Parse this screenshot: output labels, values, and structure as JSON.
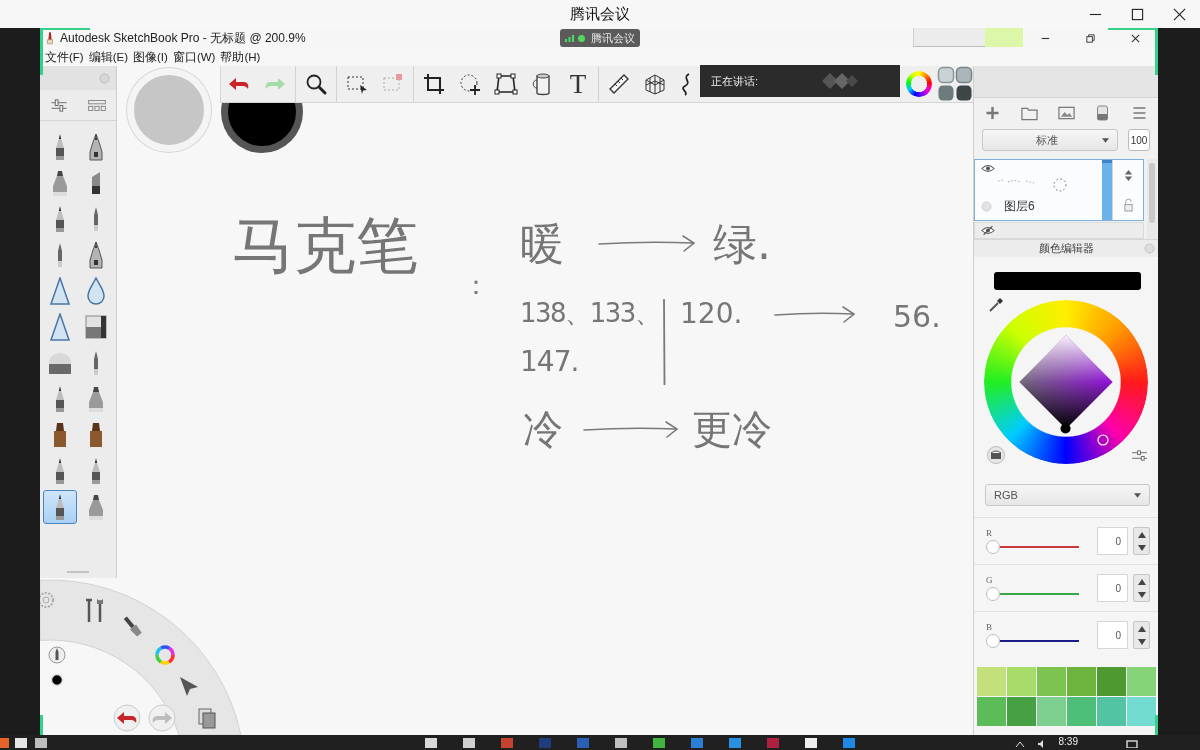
{
  "meeting": {
    "title": "腾讯会议",
    "badge": "腾讯会议",
    "speaking_label": "正在讲话:"
  },
  "app": {
    "title": "Autodesk SketchBook Pro - 无标题 @ 200.9%",
    "menu": [
      "文件(F)",
      "编辑(E)",
      "图像(I)",
      "窗口(W)",
      "帮助(H)"
    ]
  },
  "toolbar": {
    "text_tool": "T"
  },
  "brushes": [
    {
      "selected": false
    },
    {
      "selected": false
    },
    {
      "selected": false
    },
    {
      "selected": false
    },
    {
      "selected": false
    },
    {
      "selected": false
    },
    {
      "selected": false
    },
    {
      "selected": false
    },
    {
      "selected": false
    },
    {
      "selected": false
    },
    {
      "selected": false
    },
    {
      "selected": false
    },
    {
      "selected": false
    },
    {
      "selected": false
    },
    {
      "selected": false
    },
    {
      "selected": false
    },
    {
      "selected": false
    },
    {
      "selected": false
    },
    {
      "selected": false
    },
    {
      "selected": false
    },
    {
      "selected": true
    },
    {
      "selected": false
    }
  ],
  "canvas": {
    "notes": [
      "马克笔",
      "：",
      "暖",
      "绿.",
      "138、133、",
      "120.",
      "56.",
      "147.",
      "冷",
      "更冷"
    ]
  },
  "layers": {
    "blend_mode": "标准",
    "opacity": "100",
    "items": [
      {
        "name": "图层6",
        "visible": true,
        "selected": true
      },
      {
        "visible": false,
        "selected": false
      }
    ]
  },
  "color_editor": {
    "title": "颜色编辑器",
    "mode": "RGB",
    "channels": [
      {
        "label": "R",
        "value": "0",
        "level": 0,
        "color": "#c8383c"
      },
      {
        "label": "G",
        "value": "0",
        "level": 0,
        "color": "#3aa84a"
      },
      {
        "label": "B",
        "value": "0",
        "level": 0,
        "color": "#1c1c86"
      }
    ],
    "swatches": [
      {
        "color": "#c3e07a"
      },
      {
        "color": "#a8dc6a"
      },
      {
        "color": "#7cc350"
      },
      {
        "color": "#6cb43e"
      },
      {
        "color": "#4f9a30"
      },
      {
        "color": "#86d477"
      },
      {
        "color": "#5cbc58"
      },
      {
        "color": "#47a044"
      },
      {
        "color": "#7ccf8e"
      },
      {
        "color": "#4dbf78"
      },
      {
        "color": "#52c4a4"
      },
      {
        "color": "#72dcd0"
      }
    ]
  },
  "taskbar": {
    "time": "8:39"
  }
}
